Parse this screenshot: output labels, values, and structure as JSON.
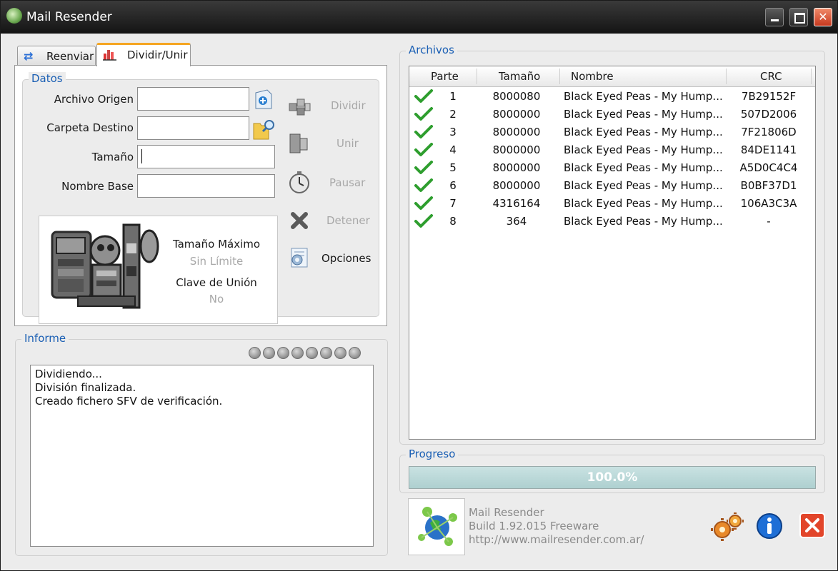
{
  "window": {
    "title": "Mail Resender"
  },
  "tabs": [
    {
      "label": "Reenviar",
      "icon": "refresh-icon"
    },
    {
      "label": "Dividir/Unir",
      "icon": "chart-icon"
    }
  ],
  "datos": {
    "legend": "Datos",
    "archivo_origen_label": "Archivo Origen",
    "carpeta_destino_label": "Carpeta Destino",
    "tamano_label": "Tamaño",
    "nombre_base_label": "Nombre Base",
    "archivo_origen_value": "",
    "carpeta_destino_value": "",
    "tamano_value": "",
    "nombre_base_value": "",
    "info": {
      "tamano_maximo_label": "Tamaño Máximo",
      "tamano_maximo_value": "Sin Límite",
      "clave_union_label": "Clave de Unión",
      "clave_union_value": "No"
    }
  },
  "commands": {
    "dividir": "Dividir",
    "unir": "Unir",
    "pausar": "Pausar",
    "detener": "Detener",
    "opciones": "Opciones"
  },
  "informe": {
    "legend": "Informe",
    "lines": [
      "Dividiendo...",
      "División finalizada.",
      "Creado fichero SFV de verificación."
    ]
  },
  "archivos": {
    "legend": "Archivos",
    "columns": [
      "Parte",
      "Tamaño",
      "Nombre",
      "CRC"
    ],
    "rows": [
      {
        "parte": "1",
        "tamano": "8000080",
        "nombre": "Black Eyed Peas - My Hump...",
        "crc": "7B29152F"
      },
      {
        "parte": "2",
        "tamano": "8000000",
        "nombre": "Black Eyed Peas - My Hump...",
        "crc": "507D2006"
      },
      {
        "parte": "3",
        "tamano": "8000000",
        "nombre": "Black Eyed Peas - My Hump...",
        "crc": "7F21806D"
      },
      {
        "parte": "4",
        "tamano": "8000000",
        "nombre": "Black Eyed Peas - My Hump...",
        "crc": "84DE1141"
      },
      {
        "parte": "5",
        "tamano": "8000000",
        "nombre": "Black Eyed Peas - My Hump...",
        "crc": "A5D0C4C4"
      },
      {
        "parte": "6",
        "tamano": "8000000",
        "nombre": "Black Eyed Peas - My Hump...",
        "crc": "B0BF37D1"
      },
      {
        "parte": "7",
        "tamano": "4316164",
        "nombre": "Black Eyed Peas - My Hump...",
        "crc": "106A3C3A"
      },
      {
        "parte": "8",
        "tamano": "364",
        "nombre": "Black Eyed Peas - My Hump...",
        "crc": "-"
      }
    ]
  },
  "progreso": {
    "legend": "Progreso",
    "value_text": "100.0%",
    "fraction": 1.0
  },
  "about": {
    "name": "Mail Resender",
    "build": "Build 1.92.015 Freeware",
    "url": "http://www.mailresender.com.ar/"
  },
  "colors": {
    "accent_blue": "#1a5fb4",
    "tab_highlight": "#f5a623",
    "check_green": "#2e9e2e",
    "close_red": "#d63a1e"
  }
}
